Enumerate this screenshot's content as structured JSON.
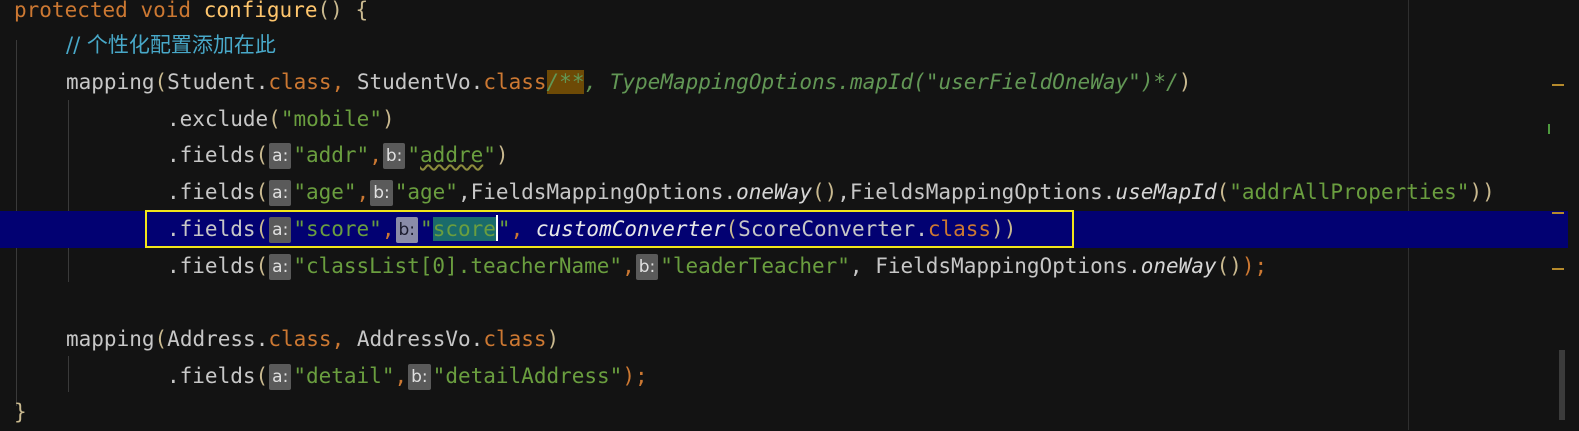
{
  "code": {
    "l1": {
      "kw1": "protected",
      "kw2": "void",
      "name": "configure",
      "parens": "()",
      "brace": "{"
    },
    "l2": {
      "comment": "// 个性化配置添加在此"
    },
    "l3": {
      "call": "mapping",
      "open": "(",
      "cls1": "Student",
      "dot1": ".",
      "kw1": "class",
      "comma": ", ",
      "cls2": "StudentVo",
      "dot2": ".",
      "kw2": "class",
      "docstart": "/**",
      "doc": ", TypeMappingOptions.mapId(\"userFieldOneWay\")*/",
      "close": ")"
    },
    "l4": {
      "method": ".exclude",
      "open": "(",
      "str": "\"mobile\"",
      "close": ")"
    },
    "l5": {
      "method": ".fields",
      "open": "(",
      "hint_a": "a:",
      "str1": "\"addr\"",
      "comma": ",",
      "hint_b": "b:",
      "q1": "\"",
      "str2": "addre",
      "q2": "\"",
      "close": ")"
    },
    "l6": {
      "method": ".fields",
      "open": "(",
      "hint_a": "a:",
      "str1": "\"age\"",
      "comma": ",",
      "hint_b": "b:",
      "str2": "\"age\"",
      "opt1": ",FieldsMappingOptions.",
      "fn1": "oneWay",
      "p1": "()",
      "opt2": ",FieldsMappingOptions.",
      "fn2": "useMapId",
      "open2": "(",
      "str3": "\"addrAllProperties\"",
      "close": "))"
    },
    "l7": {
      "method": ".fields",
      "open": "(",
      "hint_a": "a:",
      "str1": "\"score\"",
      "comma": ",",
      "hint_b": "b:",
      "q1": "\"",
      "str2": "score",
      "q2": "\"",
      "comma2": ", ",
      "fn": "customConverter",
      "open2": "(",
      "cls": "ScoreConverter",
      "dot": ".",
      "kw": "class",
      "close": "))"
    },
    "l8": {
      "method": ".fields",
      "open": "(",
      "hint_a": "a:",
      "str1": "\"classList[0].teacherName\"",
      "comma": ",",
      "hint_b": "b:",
      "str2": "\"leaderTeacher\"",
      "opt": ", FieldsMappingOptions.",
      "fn": "oneWay",
      "p": "()",
      "close": ");"
    },
    "l10": {
      "call": "mapping",
      "open": "(",
      "cls1": "Address",
      "dot1": ".",
      "kw1": "class",
      "comma": ", ",
      "cls2": "AddressVo",
      "dot2": ".",
      "kw2": "class",
      "close": ")"
    },
    "l11": {
      "method": ".fields",
      "open": "(",
      "hint_a": "a:",
      "str1": "\"detail\"",
      "comma": ",",
      "hint_b": "b:",
      "str2": "\"detailAddress\"",
      "close": ");"
    },
    "l12": {
      "brace": "}"
    }
  },
  "colors": {
    "background": "#131313",
    "current_line": "#020172",
    "keyword": "#cc7832",
    "string": "#6a9e3f",
    "comment": "#48a8c8",
    "highlight_outline": "#f2e51a"
  }
}
